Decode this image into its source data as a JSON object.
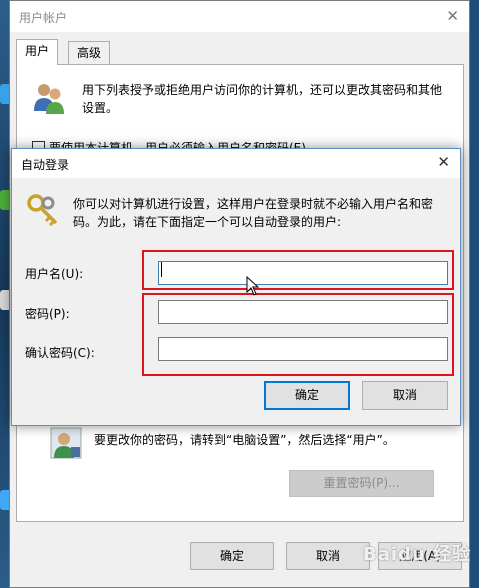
{
  "parent_window": {
    "title": "用户帐户",
    "tabs": [
      {
        "label": "用户",
        "active": true
      },
      {
        "label": "高级",
        "active": false
      }
    ],
    "description": "用下列表授予或拒绝用户访问你的计算机，还可以更改其密码和其他设置。",
    "checkbox_label": "要使用本计算机，用户必须输入用户名和密码(E)",
    "checkbox_checked": false,
    "password_hint": "要更改你的密码，请转到“电脑设置”，然后选择“用户”。",
    "reset_password_button": "重置密码(P)...",
    "ok_button": "确定",
    "cancel_button": "取消",
    "apply_button": "应用(A)"
  },
  "dialog": {
    "title": "自动登录",
    "description": "你可以对计算机进行设置，这样用户在登录时就不必输入用户名和密码。为此，请在下面指定一个可以自动登录的用户:",
    "fields": {
      "username": {
        "label": "用户名(U):",
        "value": ""
      },
      "password": {
        "label": "密码(P):",
        "value": ""
      },
      "confirm": {
        "label": "确认密码(C):",
        "value": ""
      }
    },
    "ok_button": "确定",
    "cancel_button": "取消"
  },
  "watermark": "Baidu 经验",
  "colors": {
    "highlight_box": "#e0141e",
    "focus_border": "#0078d7",
    "desktop": "#1d4e7a"
  }
}
